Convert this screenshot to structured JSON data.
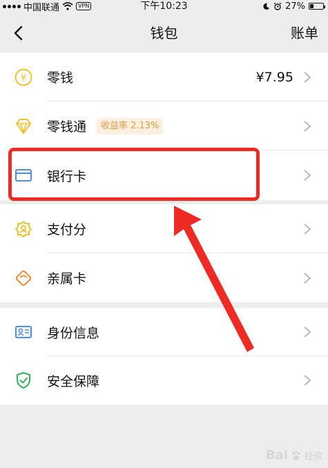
{
  "status_bar": {
    "carrier": "中国联通",
    "vpn": "VPN",
    "time": "下午10:23",
    "battery": "27%",
    "battery_level": 0.27
  },
  "nav": {
    "title": "钱包",
    "right_label": "账单"
  },
  "groups": [
    {
      "items": [
        {
          "label": "零钱",
          "value": "¥7.95",
          "icon": "yuan-coin-icon"
        },
        {
          "label": "零钱通",
          "badge": "收益率 2.13%",
          "icon": "diamond-icon"
        },
        {
          "label": "银行卡",
          "icon": "bank-card-icon"
        }
      ]
    },
    {
      "items": [
        {
          "label": "支付分",
          "icon": "pay-score-icon"
        },
        {
          "label": "亲属卡",
          "icon": "family-card-icon"
        }
      ]
    },
    {
      "items": [
        {
          "label": "身份信息",
          "icon": "id-card-icon"
        },
        {
          "label": "安全保障",
          "icon": "shield-check-icon"
        }
      ]
    }
  ],
  "colors": {
    "accent_gold": "#f0c22e",
    "accent_blue": "#4a8fd8",
    "accent_orange": "#f0892a",
    "accent_green": "#2bb05b",
    "highlight_red": "#ee2a24"
  },
  "watermark": {
    "logo_text": "Bai",
    "site_text": "经验"
  }
}
